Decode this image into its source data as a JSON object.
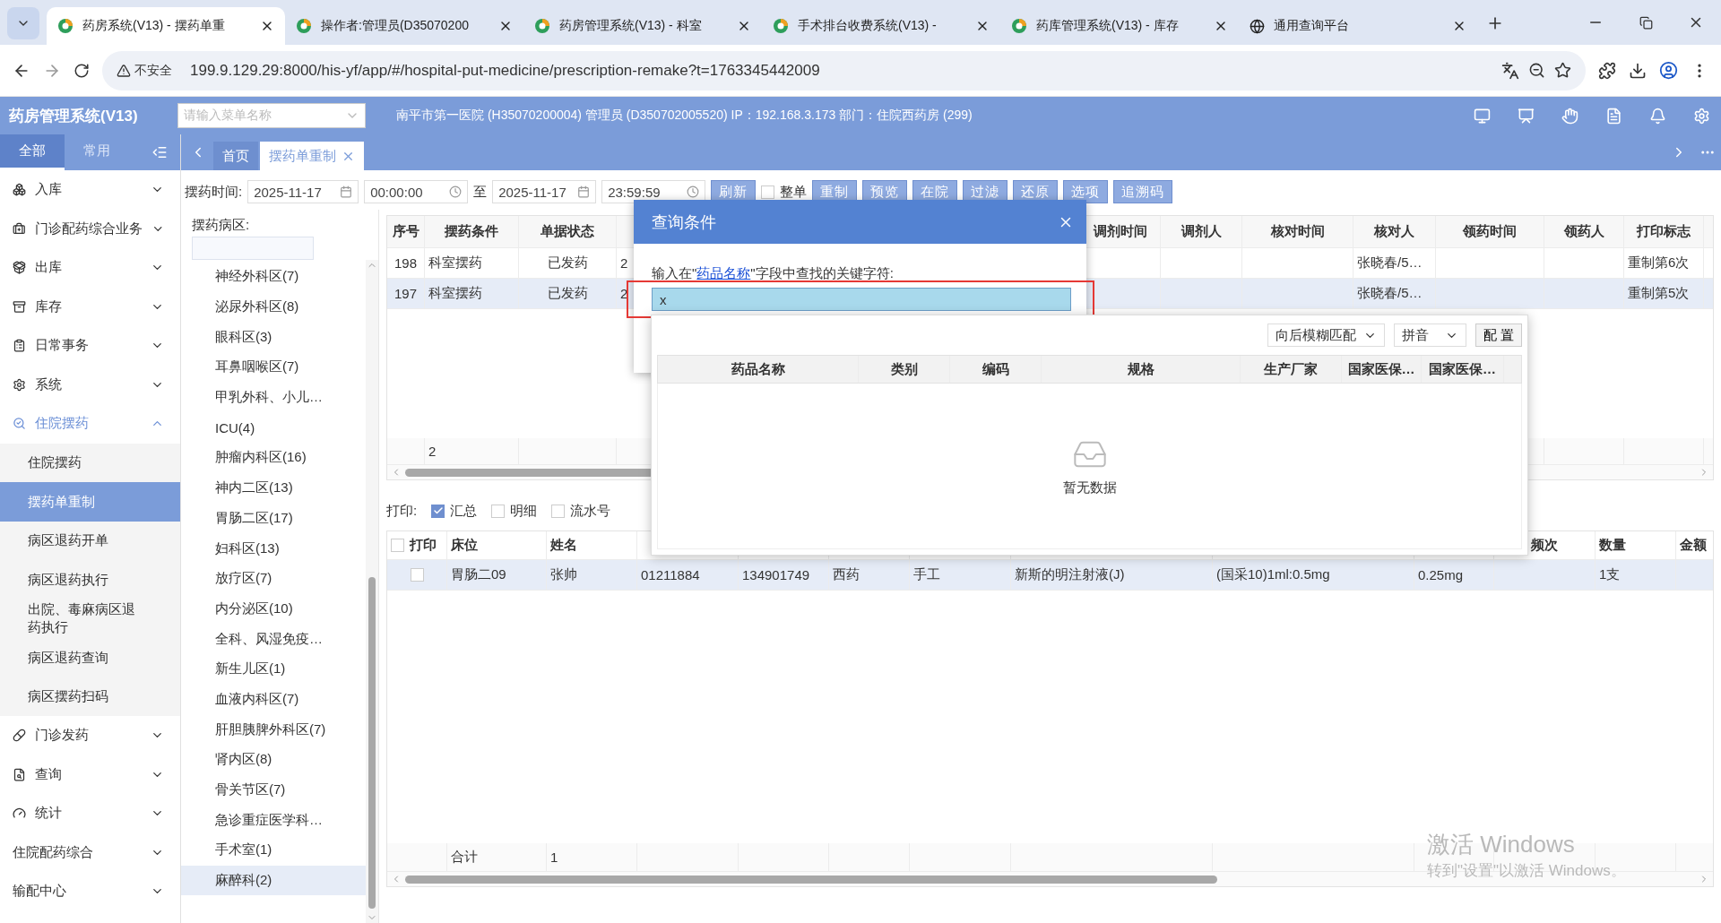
{
  "browser": {
    "tabs": [
      {
        "title": "药房系统(V13) - 摆药单重",
        "selected": true
      },
      {
        "title": "操作者:管理员(D35070200",
        "selected": false
      },
      {
        "title": "药房管理系统(V13) - 科室",
        "selected": false
      },
      {
        "title": "手术排台收费系统(V13) - ",
        "selected": false
      },
      {
        "title": "药库管理系统(V13) - 库存",
        "selected": false
      },
      {
        "title": "通用查询平台",
        "selected": false
      }
    ],
    "security_label": "不安全",
    "url": "199.9.129.29:8000/his-yf/app/#/hospital-put-medicine/prescription-remake?t=1763345442009"
  },
  "app_header": {
    "title": "药房管理系统(V13)",
    "menu_search": {
      "placeholder": "请输入菜单名称"
    },
    "info": "南平市第一医院 (H35070200004) 管理员 (D350702005520) IP：192.168.3.173 部门：住院西药房 (299)"
  },
  "sidebar": {
    "tabs": [
      {
        "label": "全部",
        "selected": true
      },
      {
        "label": "常用",
        "selected": false
      }
    ],
    "items": [
      {
        "label": "入库",
        "expanded": false
      },
      {
        "label": "门诊配药综合业务",
        "expanded": false
      },
      {
        "label": "出库",
        "expanded": false
      },
      {
        "label": "库存",
        "expanded": false
      },
      {
        "label": "日常事务",
        "expanded": false
      },
      {
        "label": "系统",
        "expanded": false
      },
      {
        "label": "住院摆药",
        "expanded": true,
        "children": [
          {
            "label": "住院摆药",
            "selected": false
          },
          {
            "label": "摆药单重制",
            "selected": true
          },
          {
            "label": "病区退药开单",
            "selected": false
          },
          {
            "label": "病区退药执行",
            "selected": false
          },
          {
            "label": "出院、毒麻病区退药执行",
            "selected": false
          },
          {
            "label": "病区退药查询",
            "selected": false
          },
          {
            "label": "病区摆药扫码",
            "selected": false
          }
        ]
      },
      {
        "label": "门诊发药",
        "expanded": false
      },
      {
        "label": "查询",
        "expanded": false
      },
      {
        "label": "统计",
        "expanded": false
      },
      {
        "label": "住院配药综合",
        "expanded": false
      },
      {
        "label": "输配中心",
        "expanded": false
      }
    ]
  },
  "page_tabs": [
    {
      "label": "首页",
      "selected": false,
      "closable": false
    },
    {
      "label": "摆药单重制",
      "selected": true,
      "closable": true
    }
  ],
  "toolbar": {
    "time_label": "摆药时间:",
    "start_date": "2025-11-17",
    "start_time": "00:00:00",
    "to_label": "至",
    "end_date": "2025-11-17",
    "end_time": "23:59:59",
    "items": [
      {
        "kind": "button",
        "label": "刷新"
      },
      {
        "kind": "checkbox",
        "label": "整单",
        "checked": false
      },
      {
        "kind": "button",
        "label": "重制"
      },
      {
        "kind": "button",
        "label": "预览"
      },
      {
        "kind": "button",
        "label": "在院"
      },
      {
        "kind": "button",
        "label": "过滤"
      },
      {
        "kind": "button",
        "label": "还原"
      },
      {
        "kind": "button",
        "label": "选项"
      },
      {
        "kind": "button",
        "label": "追溯码"
      }
    ]
  },
  "ward_panel": {
    "label": "摆药病区:",
    "wards": [
      {
        "label": "神经外科区(7)",
        "selected": false
      },
      {
        "label": "泌尿外科区(8)",
        "selected": false
      },
      {
        "label": "眼科区(3)",
        "selected": false
      },
      {
        "label": "耳鼻咽喉区(7)",
        "selected": false
      },
      {
        "label": "甲乳外科、小儿…",
        "selected": false
      },
      {
        "label": "ICU(4)",
        "selected": false
      },
      {
        "label": "肿瘤内科区(16)",
        "selected": false
      },
      {
        "label": "神内二区(13)",
        "selected": false
      },
      {
        "label": "胃肠二区(17)",
        "selected": false
      },
      {
        "label": "妇科区(13)",
        "selected": false
      },
      {
        "label": "放疗区(7)",
        "selected": false
      },
      {
        "label": "内分泌区(10)",
        "selected": false
      },
      {
        "label": "全科、风湿免疫…",
        "selected": false
      },
      {
        "label": "新生儿区(1)",
        "selected": false
      },
      {
        "label": "血液内科区(7)",
        "selected": false
      },
      {
        "label": "肝胆胰脾外科区(7)",
        "selected": false
      },
      {
        "label": "肾内区(8)",
        "selected": false
      },
      {
        "label": "骨关节区(7)",
        "selected": false
      },
      {
        "label": "急诊重症医学科…",
        "selected": false
      },
      {
        "label": "手术室(1)",
        "selected": false
      },
      {
        "label": "麻醉科(2)",
        "selected": true
      }
    ]
  },
  "upper_table": {
    "columns": {
      "seq": "序号",
      "condition": "摆药条件",
      "status": "单据状态",
      "dispense_time": "调剂时间",
      "dispenser": "调剂人",
      "check_time": "核对时间",
      "checker": "核对人",
      "collect_time": "领药时间",
      "collector": "领药人",
      "print_flag": "打印标志"
    },
    "rows": [
      {
        "selected": false,
        "cells": {
          "seq": "198",
          "condition": "科室摆药",
          "status": "已发药",
          "column_4": "2",
          "checker": "张晓春/5…",
          "print_flag": "重制第6次"
        }
      },
      {
        "selected": true,
        "cells": {
          "seq": "197",
          "condition": "科室摆药",
          "status": "已发药",
          "column_4": "2",
          "checker": "张晓春/5…",
          "print_flag": "重制第5次"
        }
      }
    ],
    "footer": {
      "condition": "2"
    }
  },
  "print_options": {
    "label": "打印:",
    "options": [
      {
        "label": "汇总",
        "checked": true
      },
      {
        "label": "明细",
        "checked": false
      },
      {
        "label": "流水号",
        "checked": false
      }
    ]
  },
  "lower_table": {
    "select_all_checked": false,
    "columns": {
      "print": "打印",
      "bed": "床位",
      "name": "姓名",
      "frequency": "频次",
      "quantity": "数量",
      "amount": "金额"
    },
    "rows": [
      {
        "selected": true,
        "checked": false,
        "cells": {
          "bed": "胃肠二09",
          "name": "张帅",
          "column_4": "01211884",
          "column_5": "134901749",
          "column_6": "西药",
          "column_7": "手工",
          "column_8": "新斯的明注射液(J)",
          "column_9": "(国采10)1ml:0.5mg",
          "column_10": "0.25mg",
          "quantity": "1支"
        }
      }
    ],
    "footer": {
      "bed": "合计",
      "name": "1"
    }
  },
  "query_dialog": {
    "title": "查询条件",
    "prompt": {
      "before": "输入在\"",
      "field": "药品名称",
      "after": "\"字段中查找的关键字符:"
    },
    "value": "x",
    "match_mode": "向后模糊匹配",
    "input_mode": "拼音",
    "config_button": "配 置",
    "columns": [
      "药品名称",
      "类别",
      "编码",
      "规格",
      "生产厂家",
      "国家医保…",
      "国家医保…"
    ],
    "empty_text": "暂无数据"
  },
  "os_watermark": {
    "title": "激活 Windows",
    "subtitle": "转到\"设置\"以激活 Windows。"
  }
}
